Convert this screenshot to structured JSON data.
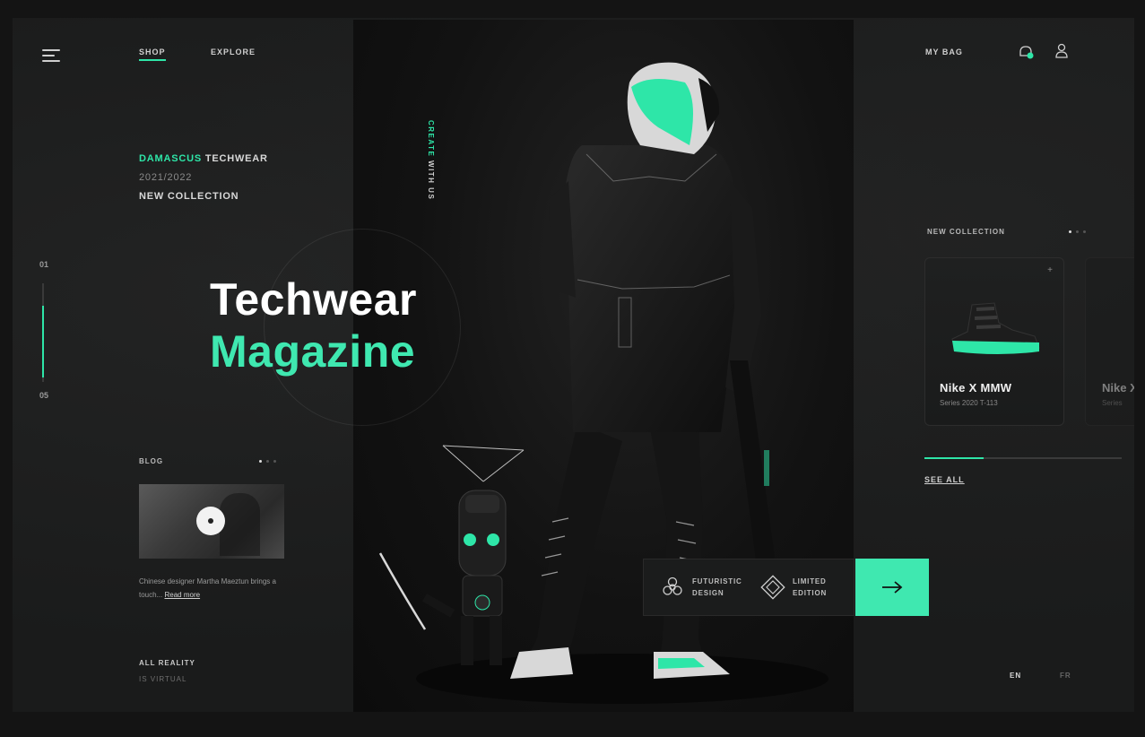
{
  "nav": {
    "links": [
      {
        "label": "SHOP",
        "active": true
      },
      {
        "label": "EXPLORE",
        "active": false
      }
    ],
    "bag_label": "MY BAG"
  },
  "collection": {
    "brand_accent": "DAMASCUS",
    "brand_rest": " TECHWEAR",
    "year": "2021/2022",
    "label": "NEW COLLECTION"
  },
  "slider": {
    "top": "01",
    "bottom": "05",
    "progress": 0.75
  },
  "headline": {
    "line1": "Techwear",
    "line2": "Magazine"
  },
  "hero": {
    "vertical_accent": "CREATE",
    "vertical_rest": " WITH US"
  },
  "blog": {
    "label": "BLOG",
    "text": "Chinese designer Martha Maeztun brings a touch...",
    "read_more": "Read more"
  },
  "all_reality": {
    "title": "ALL REALITY",
    "subtitle": "IS VIRTUAL"
  },
  "features": [
    {
      "line1": "FUTURISTIC",
      "line2": "DESIGN",
      "icon": "biohazard-icon"
    },
    {
      "line1": "LIMITED",
      "line2": "EDITION",
      "icon": "diamond-badge-icon"
    }
  ],
  "right": {
    "label": "NEW COLLECTION",
    "products": [
      {
        "name": "Nike X MMW",
        "meta": "Series 2020 T-113"
      },
      {
        "name": "Nike X",
        "meta": "Series"
      }
    ],
    "progress": 0.3,
    "see_all": "SEE ALL"
  },
  "lang": {
    "active": "EN",
    "inactive": "FR"
  },
  "colors": {
    "accent": "#2ee6a8",
    "background": "#1a1b1b"
  }
}
